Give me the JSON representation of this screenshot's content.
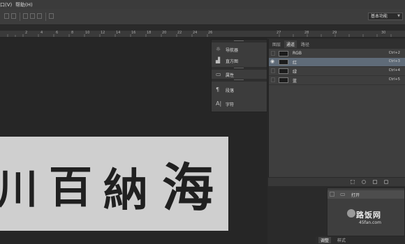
{
  "menubar": {
    "items": [
      {
        "label": "口(V)"
      },
      {
        "label": "帮助(H)"
      }
    ]
  },
  "toolbar": {
    "workspace": "基本功能"
  },
  "ruler": {
    "ticks": [
      "2",
      "4",
      "6",
      "8",
      "10",
      "12",
      "14",
      "16",
      "18",
      "20",
      "22",
      "24",
      "26",
      "27",
      "28",
      "29",
      "30"
    ]
  },
  "dock": {
    "items": [
      {
        "icon": "navigator-icon",
        "label": "导航器"
      },
      {
        "icon": "histogram-icon",
        "label": "直方图"
      },
      {
        "icon": "properties-icon",
        "label": "属性"
      },
      {
        "icon": "paragraph-icon",
        "label": "段落"
      },
      {
        "icon": "character-icon",
        "label": "字符"
      }
    ]
  },
  "channels": {
    "tabs": [
      {
        "label": "图层"
      },
      {
        "label": "通道",
        "active": true
      },
      {
        "label": "路径"
      }
    ],
    "rows": [
      {
        "name": "RGB",
        "shortcut": "Ctrl+2",
        "selected": false
      },
      {
        "name": "红",
        "shortcut": "Ctrl+3",
        "selected": true
      },
      {
        "name": "绿",
        "shortcut": "Ctrl+4",
        "selected": false
      },
      {
        "name": "蓝",
        "shortcut": "Ctrl+5",
        "selected": false
      }
    ]
  },
  "actions": {
    "row_label": "打开"
  },
  "watermark": {
    "logo": "路饭网",
    "site": "45fan.com"
  },
  "bottom_tabs": [
    {
      "label": "调整",
      "active": true
    },
    {
      "label": "样式"
    }
  ],
  "calligraphy": {
    "chars": [
      "川",
      "百",
      "納",
      "海"
    ]
  }
}
